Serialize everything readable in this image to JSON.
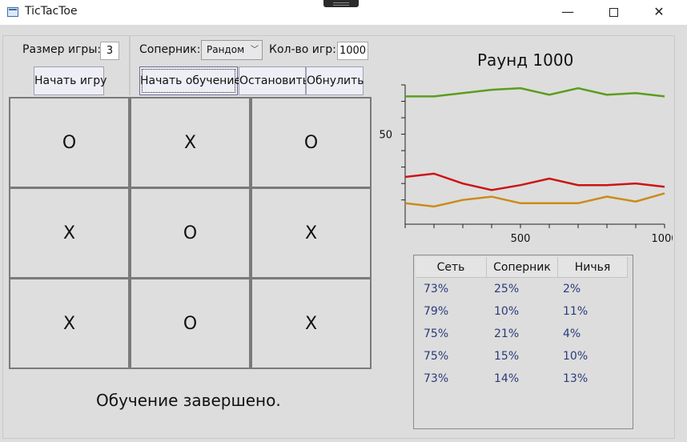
{
  "window": {
    "title": "TicTacToe",
    "minimize": "—",
    "maximize": "□",
    "close": "✕"
  },
  "controls": {
    "size_label": "Размер игры:",
    "size_value": "3",
    "start_game": "Начать игру",
    "opponent_label": "Соперник:",
    "opponent_value": "Рандом",
    "games_label": "Кол-во игр:",
    "games_value": "1000",
    "start_training": "Начать обучение",
    "stop": "Остановить",
    "reset": "Обнулить"
  },
  "board": [
    "O",
    "X",
    "O",
    "X",
    "O",
    "X",
    "X",
    "O",
    "X"
  ],
  "status": "Обучение завершено.",
  "round_label": "Раунд 1000",
  "chart_data": {
    "type": "line",
    "x": [
      100,
      200,
      300,
      400,
      500,
      600,
      700,
      800,
      900,
      1000
    ],
    "series": [
      {
        "color": "#5a9e1e",
        "values": [
          73,
          73,
          75,
          77,
          78,
          74,
          78,
          74,
          75,
          73
        ]
      },
      {
        "color": "#cc1414",
        "values": [
          24,
          26,
          20,
          16,
          19,
          23,
          19,
          19,
          20,
          18
        ]
      },
      {
        "color": "#cc8a1a",
        "values": [
          8,
          6,
          10,
          12,
          8,
          8,
          8,
          12,
          9,
          14
        ]
      }
    ],
    "xticks": [
      500,
      1000
    ],
    "yticks": [
      50
    ],
    "xlim": [
      100,
      1000
    ],
    "ylim": [
      4,
      80
    ]
  },
  "results_table": {
    "headers": [
      "Сеть",
      "Соперник",
      "Ничья"
    ],
    "rows": [
      [
        "73%",
        "25%",
        "2%"
      ],
      [
        "79%",
        "10%",
        "11%"
      ],
      [
        "75%",
        "21%",
        "4%"
      ],
      [
        "75%",
        "15%",
        "10%"
      ],
      [
        "73%",
        "14%",
        "13%"
      ]
    ]
  }
}
